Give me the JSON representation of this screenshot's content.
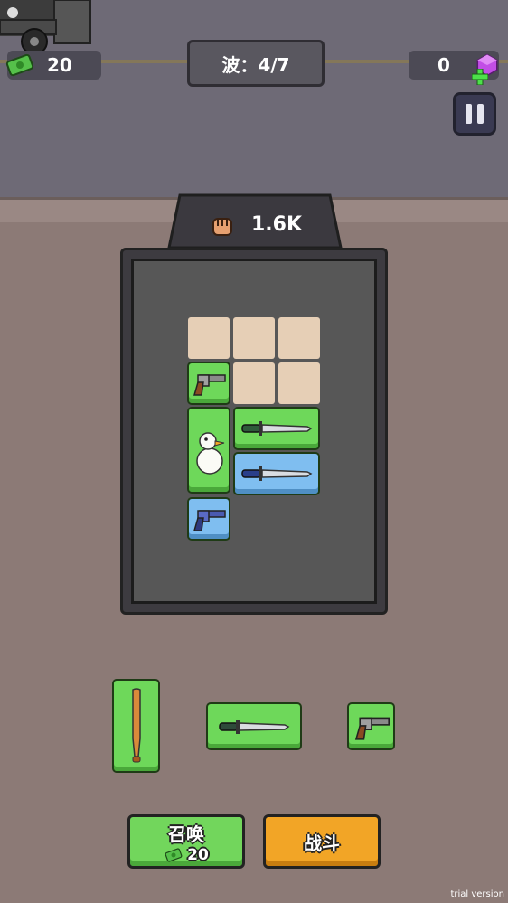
{
  "hud": {
    "cash": "20",
    "wave_label": "波：4/7",
    "gems": "0"
  },
  "power": {
    "value": "1.6K"
  },
  "board": {
    "items": [
      {
        "name": "revolver",
        "color": "green"
      },
      {
        "name": "duck",
        "color": "green"
      },
      {
        "name": "knife",
        "color": "green"
      },
      {
        "name": "knife",
        "color": "blue"
      },
      {
        "name": "revolver",
        "color": "blue"
      }
    ]
  },
  "tray": {
    "items": [
      {
        "name": "baseball-bat",
        "color": "green"
      },
      {
        "name": "knife",
        "color": "green"
      },
      {
        "name": "revolver",
        "color": "green"
      }
    ]
  },
  "actions": {
    "summon_label": "召唤",
    "summon_cost": "20",
    "battle_label": "战斗"
  },
  "watermark": "trial version",
  "colors": {
    "green_tile": "#6ed85a",
    "blue_tile": "#7fbef0",
    "summon": "#72d65c",
    "battle": "#f2a526"
  }
}
